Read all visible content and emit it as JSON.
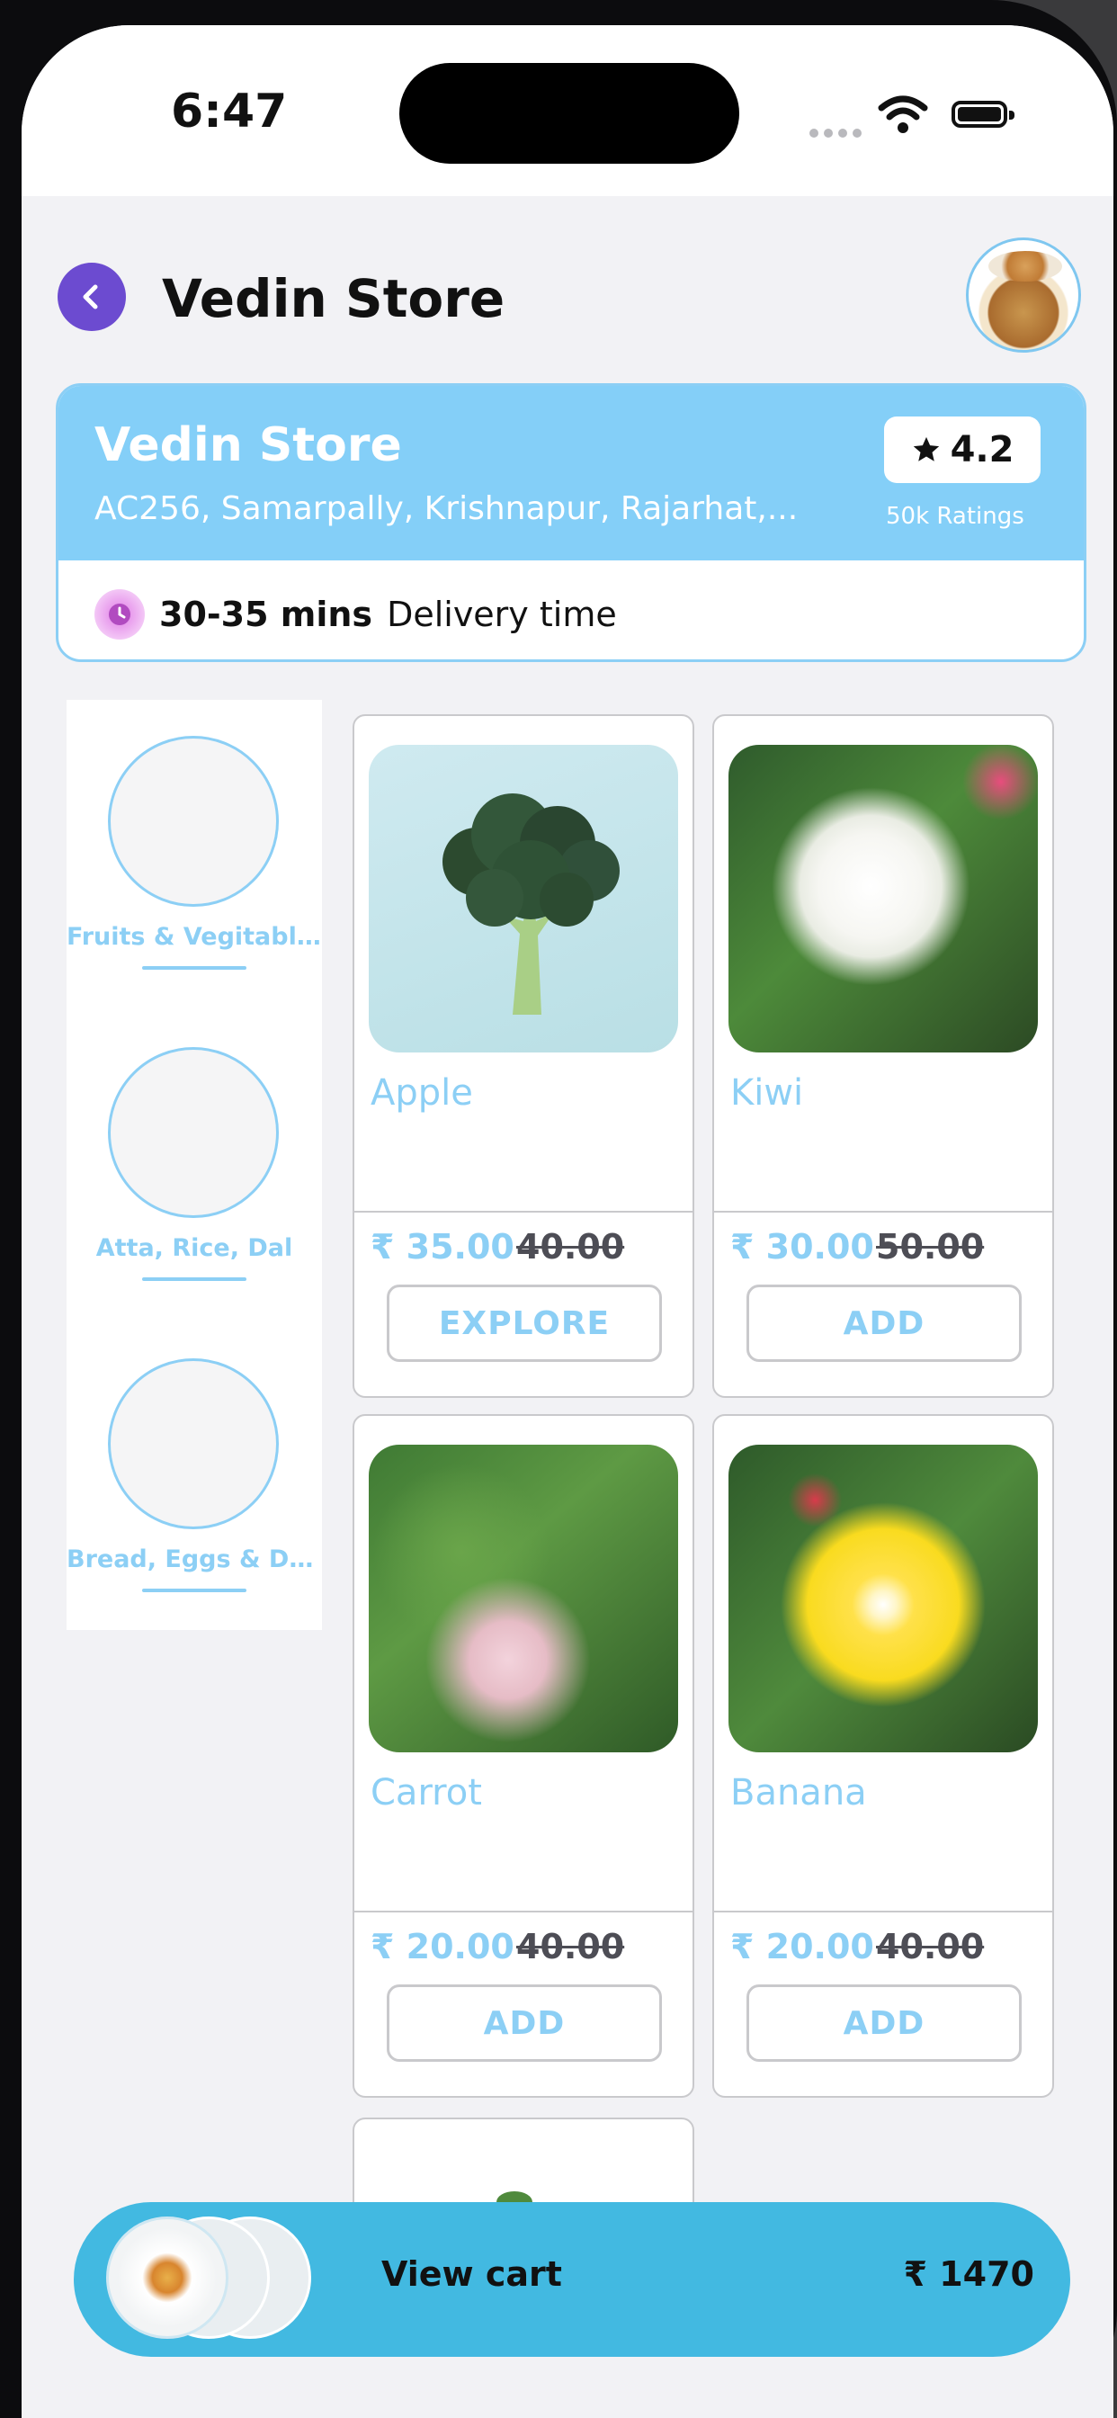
{
  "status_bar": {
    "time": "6:47"
  },
  "header": {
    "title": "Vedin Store"
  },
  "store": {
    "name": "Vedin Store",
    "address": "AC256, Samarpally, Krishnapur, Rajarhat,...",
    "rating": "4.2",
    "rating_count": "50k Ratings",
    "eta": "30-35 mins",
    "eta_label": "Delivery time"
  },
  "categories": [
    {
      "label": "Fruits & Vegitabl..."
    },
    {
      "label": "Atta, Rice, Dal"
    },
    {
      "label": "Bread, Eggs & Da..."
    }
  ],
  "products": [
    {
      "name": "Apple",
      "price": "₹ 35.00",
      "mrp": "40.00",
      "button": "EXPLORE",
      "image": "broccoli"
    },
    {
      "name": "Kiwi",
      "price": "₹ 30.00",
      "mrp": "50.00",
      "button": "ADD",
      "image": "white-hibiscus"
    },
    {
      "name": "Carrot",
      "price": "₹ 20.00",
      "mrp": "40.00",
      "button": "ADD",
      "image": "pink-leaves"
    },
    {
      "name": "Banana",
      "price": "₹ 20.00",
      "mrp": "40.00",
      "button": "ADD",
      "image": "yellow-hibiscus"
    }
  ],
  "cart": {
    "label": "View cart",
    "total": "₹ 1470"
  },
  "colors": {
    "accent_blue": "#84cff8",
    "text_blue": "#8ccff5",
    "cart_blue": "#42b9e1",
    "back_purple": "#6c4bd0"
  }
}
